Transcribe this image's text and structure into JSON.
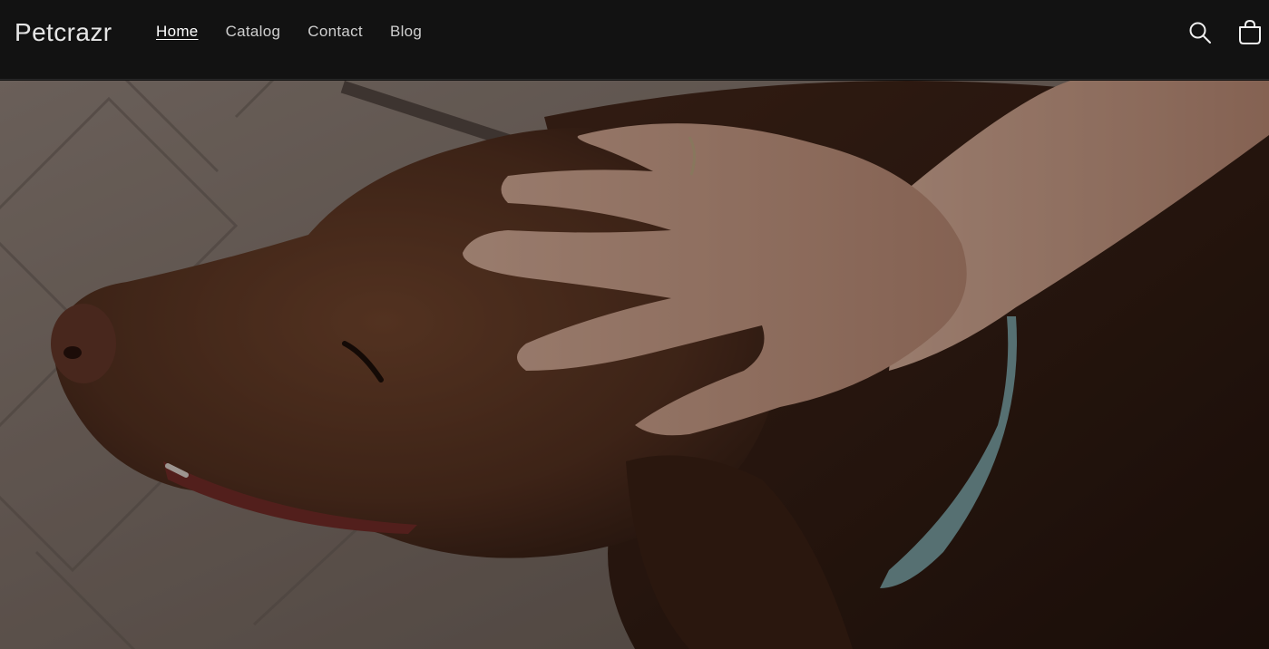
{
  "header": {
    "logo": "Petcrazr",
    "nav": [
      {
        "label": "Home",
        "active": true
      },
      {
        "label": "Catalog",
        "active": false
      },
      {
        "label": "Contact",
        "active": false
      },
      {
        "label": "Blog",
        "active": false
      }
    ],
    "icons": {
      "search": "search-icon",
      "cart": "cart-icon"
    }
  },
  "hero": {
    "image": "dog-being-petted",
    "colors": {
      "overlay": "#000000",
      "dog": "#5a3422",
      "skin": "#cfa08a",
      "pavement": "#8a7a72",
      "collar": "#7fa6a8"
    }
  }
}
